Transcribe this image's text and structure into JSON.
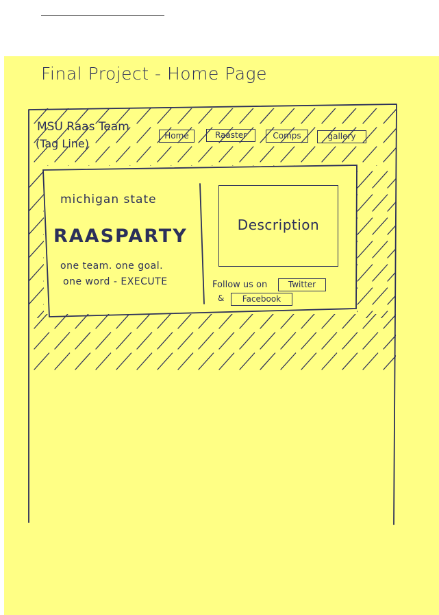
{
  "heading": "Final Project - Home Page",
  "site": {
    "title": "MSU Raas Team",
    "tagline": "(Tag Line)"
  },
  "nav": {
    "items": [
      "Home",
      "Raaster",
      "Comps",
      "gallery"
    ]
  },
  "hero": {
    "subtitle": "michigan state",
    "title": "RAASPARTY",
    "slogan_line1": "one team. one goal.",
    "slogan_line2": "one word - EXECUTE"
  },
  "description": {
    "label": "Description"
  },
  "social": {
    "follow_text": "Follow us on",
    "joiner": "&",
    "twitter_label": "Twitter",
    "facebook_label": "Facebook"
  }
}
